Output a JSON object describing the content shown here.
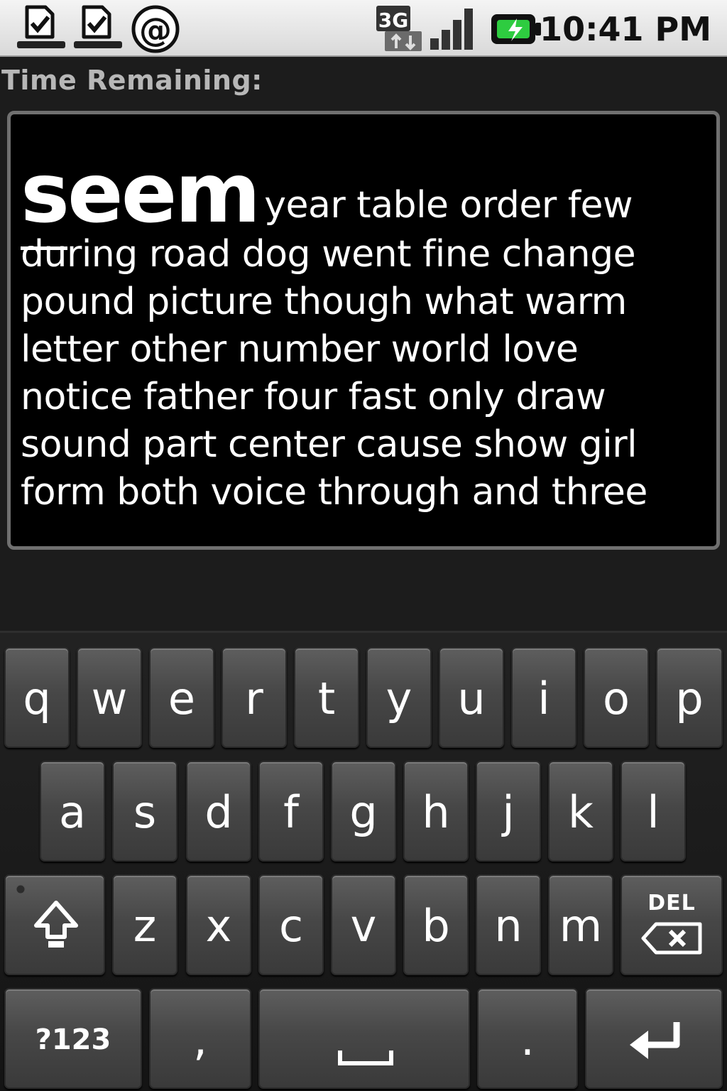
{
  "status_bar": {
    "time": "10:41 PM",
    "network_label": "3G",
    "left_icons": [
      "download-done-icon",
      "download-done-icon",
      "at-sign-icon"
    ],
    "right_icons": [
      "network-3g-icon",
      "signal-strength-icon",
      "battery-charging-icon"
    ],
    "battery_color": "#2ecc40"
  },
  "header": {
    "time_remaining_label": "Time Remaining:"
  },
  "text_panel": {
    "current_word": "seem",
    "first_line_rest": "year table order few",
    "lines": [
      "during road dog went fine change",
      "pound picture though what warm",
      "letter other number world love",
      "notice father four fast only draw",
      "sound part center cause show girl",
      "form both voice through and three"
    ]
  },
  "keyboard": {
    "row1": [
      "q",
      "w",
      "e",
      "r",
      "t",
      "y",
      "u",
      "i",
      "o",
      "p"
    ],
    "row2": [
      "a",
      "s",
      "d",
      "f",
      "g",
      "h",
      "j",
      "k",
      "l"
    ],
    "row3": [
      "z",
      "x",
      "c",
      "v",
      "b",
      "n",
      "m"
    ],
    "del_label": "DEL",
    "symbols_label": "?123",
    "comma_label": ",",
    "period_label": "."
  }
}
